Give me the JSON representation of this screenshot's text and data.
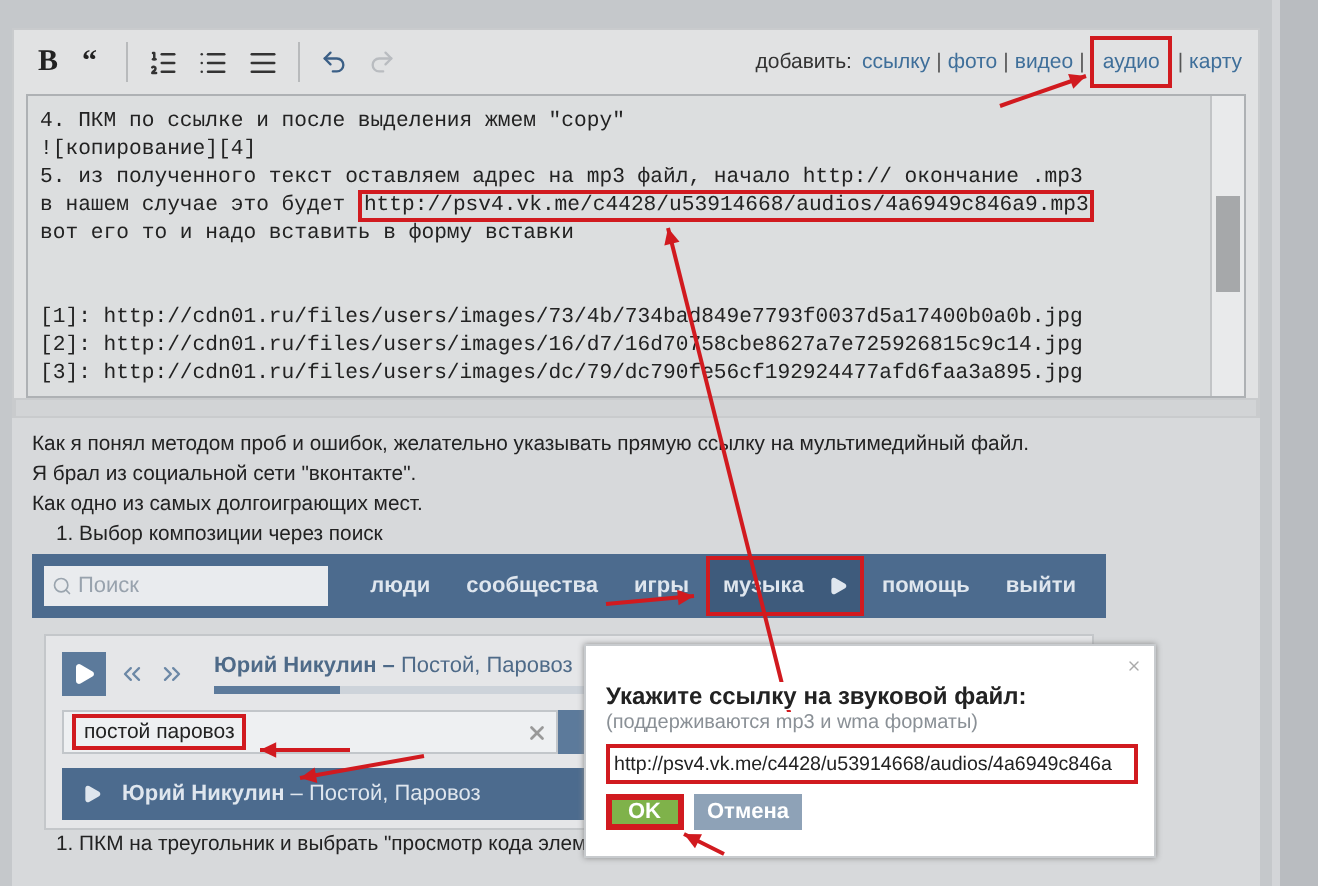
{
  "toolbar": {
    "format_buttons": [
      "B",
      "“"
    ],
    "redo_disabled": true,
    "add_label": "добавить:",
    "separator": "|",
    "add_links": [
      {
        "label": "ссылку",
        "highlighted": false
      },
      {
        "label": "фото",
        "highlighted": false
      },
      {
        "label": "видео",
        "highlighted": false
      },
      {
        "label": "аудио",
        "highlighted": true
      },
      {
        "label": "карту",
        "highlighted": false
      }
    ]
  },
  "editor": {
    "lines": [
      {
        "text": "4. ПКМ по ссылке и после выделения жмем \"copy\""
      },
      {
        "text": "![копирование][4]"
      },
      {
        "text": "5. из полученного текст оставляем адрес на mp3 файл, начало http:// окончание .mp3"
      },
      {
        "text": "в нашем случае это будет ",
        "url": "http://psv4.vk.me/c4428/u53914668/audios/4a6949c846a9.mp3",
        "url_highlighted": true
      },
      {
        "text": "вот его то и надо вставить в форму вставки"
      },
      {
        "space_before": true,
        "text": "[1]: http://cdn01.ru/files/users/images/73/4b/734bad849e7793f0037d5a17400b0a0b.jpg"
      },
      {
        "text": "[2]: http://cdn01.ru/files/users/images/16/d7/16d70758cbe8627a7e725926815c9c14.jpg"
      },
      {
        "text": "[3]: http://cdn01.ru/files/users/images/dc/79/dc790fe56cf192924477afd6faa3a895.jpg"
      }
    ]
  },
  "preview": {
    "paragraphs": [
      "Как я понял методом проб и ошибок, желательно указывать прямую ссылку на мультимедийный файл.",
      "Я брал из социальной сети \"вконтакте\".",
      "Как одно из самых долгоиграющих мест."
    ],
    "step_1": "1.  Выбор композиции через поиск",
    "step_2": "1.  ПКМ на треугольник и выбрать \"просмотр кода элем"
  },
  "vk": {
    "search_placeholder": "Поиск",
    "nav": [
      {
        "label": "люди",
        "selected": false
      },
      {
        "label": "сообщества",
        "selected": false
      },
      {
        "label": "игры",
        "selected": false
      },
      {
        "label": "музыка",
        "selected": true
      },
      {
        "label": "помощь",
        "selected": false
      },
      {
        "label": "выйти",
        "selected": false
      }
    ],
    "player": {
      "title": "**Юрий Никулин –** Постой, Паровоз",
      "level": 0.34
    },
    "search_value": "постой паровоз",
    "search_highlighted": true,
    "track": "**Юрий Никулин** – Постой, Паровоз"
  },
  "dialog": {
    "title": "Укажите ссылку на звуковой файл:",
    "hint": "(поддерживаются mp3 и wma форматы)",
    "value": "http://psv4.vk.me/c4428/u53914668/audios/4a6949c846a",
    "value_highlighted": true,
    "ok": "OK",
    "ok_highlighted": true,
    "cancel": "Отмена"
  }
}
